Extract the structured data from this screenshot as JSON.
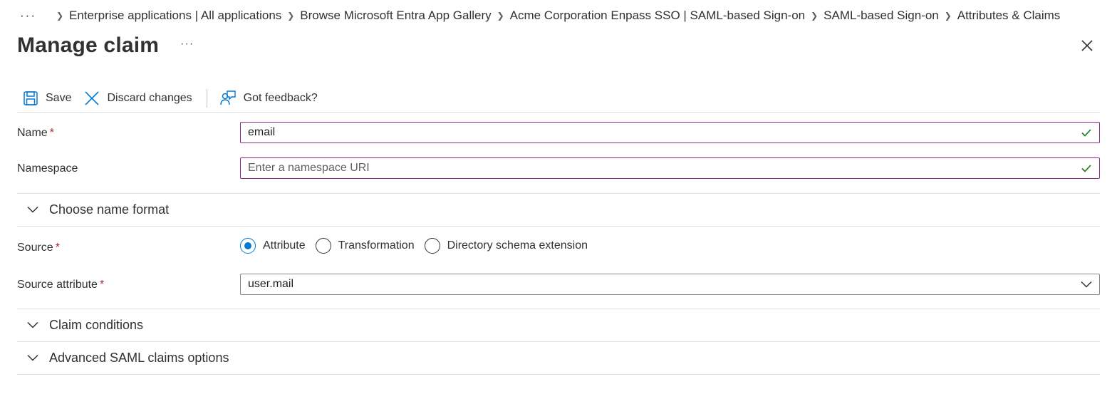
{
  "breadcrumb": {
    "more": "···",
    "items": [
      "Enterprise applications | All applications",
      "Browse Microsoft Entra App Gallery",
      "Acme Corporation Enpass SSO | SAML-based Sign-on",
      "SAML-based Sign-on",
      "Attributes & Claims"
    ]
  },
  "header": {
    "title": "Manage claim",
    "more": "···"
  },
  "toolbar": {
    "save": "Save",
    "discard": "Discard changes",
    "feedback": "Got feedback?"
  },
  "form": {
    "name_label": "Name",
    "name_value": "email",
    "namespace_label": "Namespace",
    "namespace_placeholder": "Enter a namespace URI",
    "name_format_section": "Choose name format",
    "source_label": "Source",
    "source_options": [
      "Attribute",
      "Transformation",
      "Directory schema extension"
    ],
    "source_selected": "Attribute",
    "source_attribute_label": "Source attribute",
    "source_attribute_value": "user.mail",
    "required_marker": "*"
  },
  "sections": {
    "claim_conditions": "Claim conditions",
    "advanced_options": "Advanced SAML claims options"
  },
  "colors": {
    "accent": "#0078d4",
    "valid": "#107c10",
    "required": "#a4262c",
    "input_border_active": "#8a2e8a"
  },
  "icons": [
    "more-icon",
    "chevron-right-icon",
    "close-icon",
    "save-icon",
    "discard-icon",
    "feedback-icon",
    "check-icon",
    "chevron-down-icon"
  ]
}
